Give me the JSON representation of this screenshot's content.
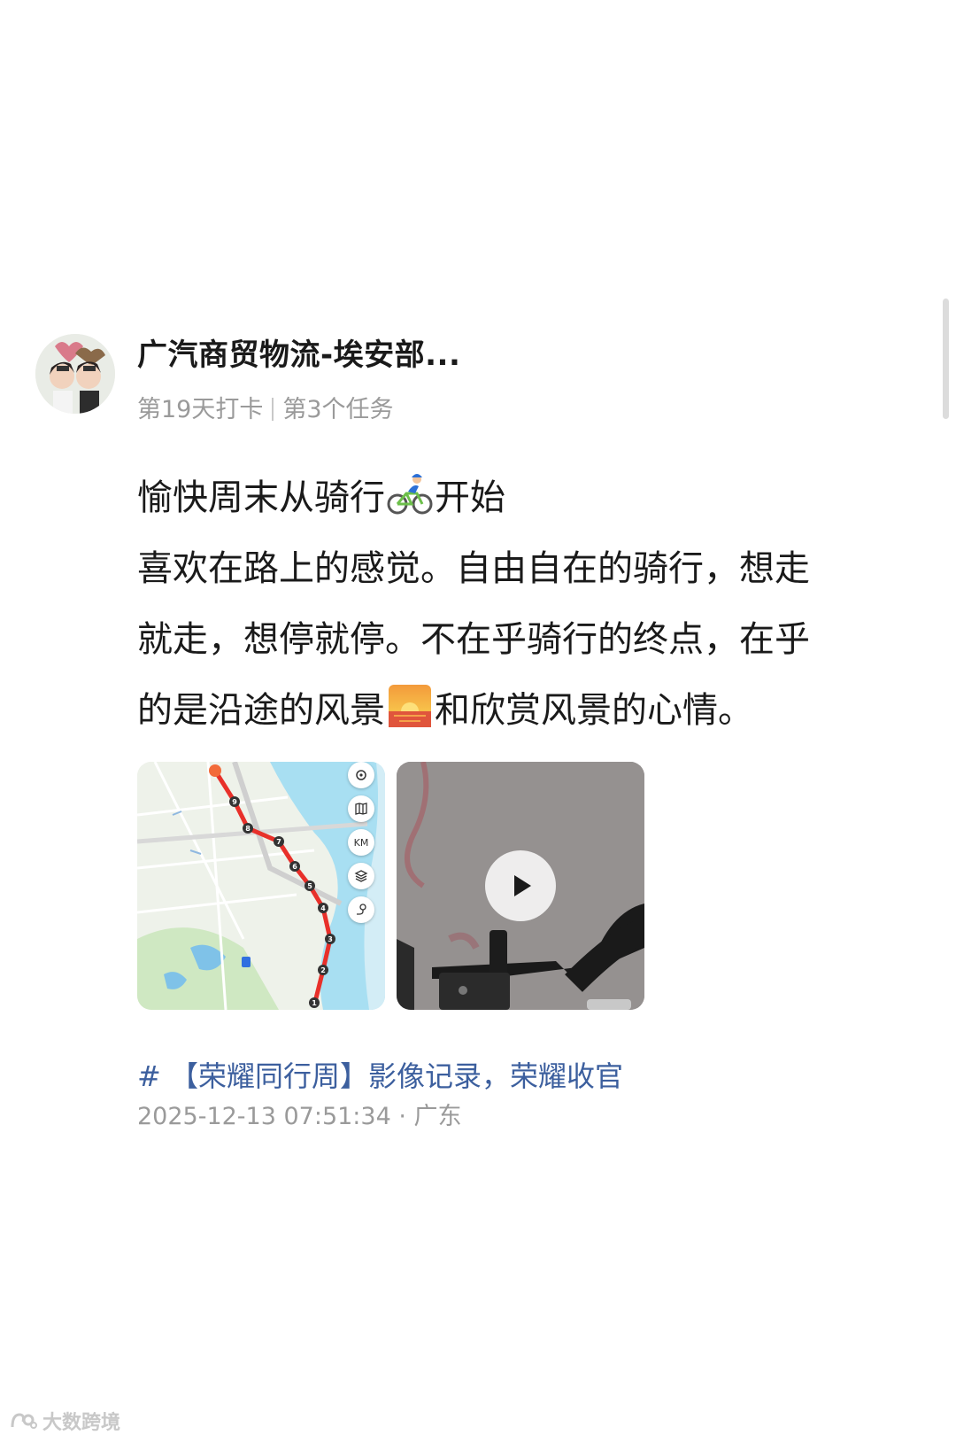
{
  "post": {
    "author_name": "广汽商贸物流-埃安部...",
    "checkin_day": "第19天打卡",
    "task": "第3个任务",
    "lines": [
      [
        "愉快周末从骑行",
        "开始"
      ],
      [
        "喜欢在路上的感觉。自由自在的骑行，想走"
      ],
      [
        "就走，想停就停。不在乎骑行的终点，在乎"
      ],
      [
        "的是沿途的风景",
        "和欣赏风景的心情。"
      ]
    ],
    "emojis": [
      "cyclist-emoji",
      "sunrise-emoji"
    ],
    "topic_hash": "#",
    "topic": "【荣耀同行周】影像记录，荣耀收官",
    "timestamp": "2025-12-13 07:51:34",
    "location": "广东",
    "dot": "·"
  },
  "map_preview": {
    "controls": [
      "locate-icon",
      "map-icon",
      "KM",
      "layers-icon",
      "route-icon"
    ],
    "km_label": "KM",
    "route_markers": [
      "9",
      "8",
      "7",
      "6",
      "5",
      "4",
      "3",
      "2",
      "1"
    ],
    "route_color": "#e8302a"
  },
  "video_preview": {
    "play_icon": "play-icon"
  },
  "watermark": {
    "text": "大数跨境"
  },
  "colors": {
    "text": "#1a1a1a",
    "muted": "#9a9a9a",
    "topic": "#3c5f9e",
    "background": "#ffffff"
  }
}
